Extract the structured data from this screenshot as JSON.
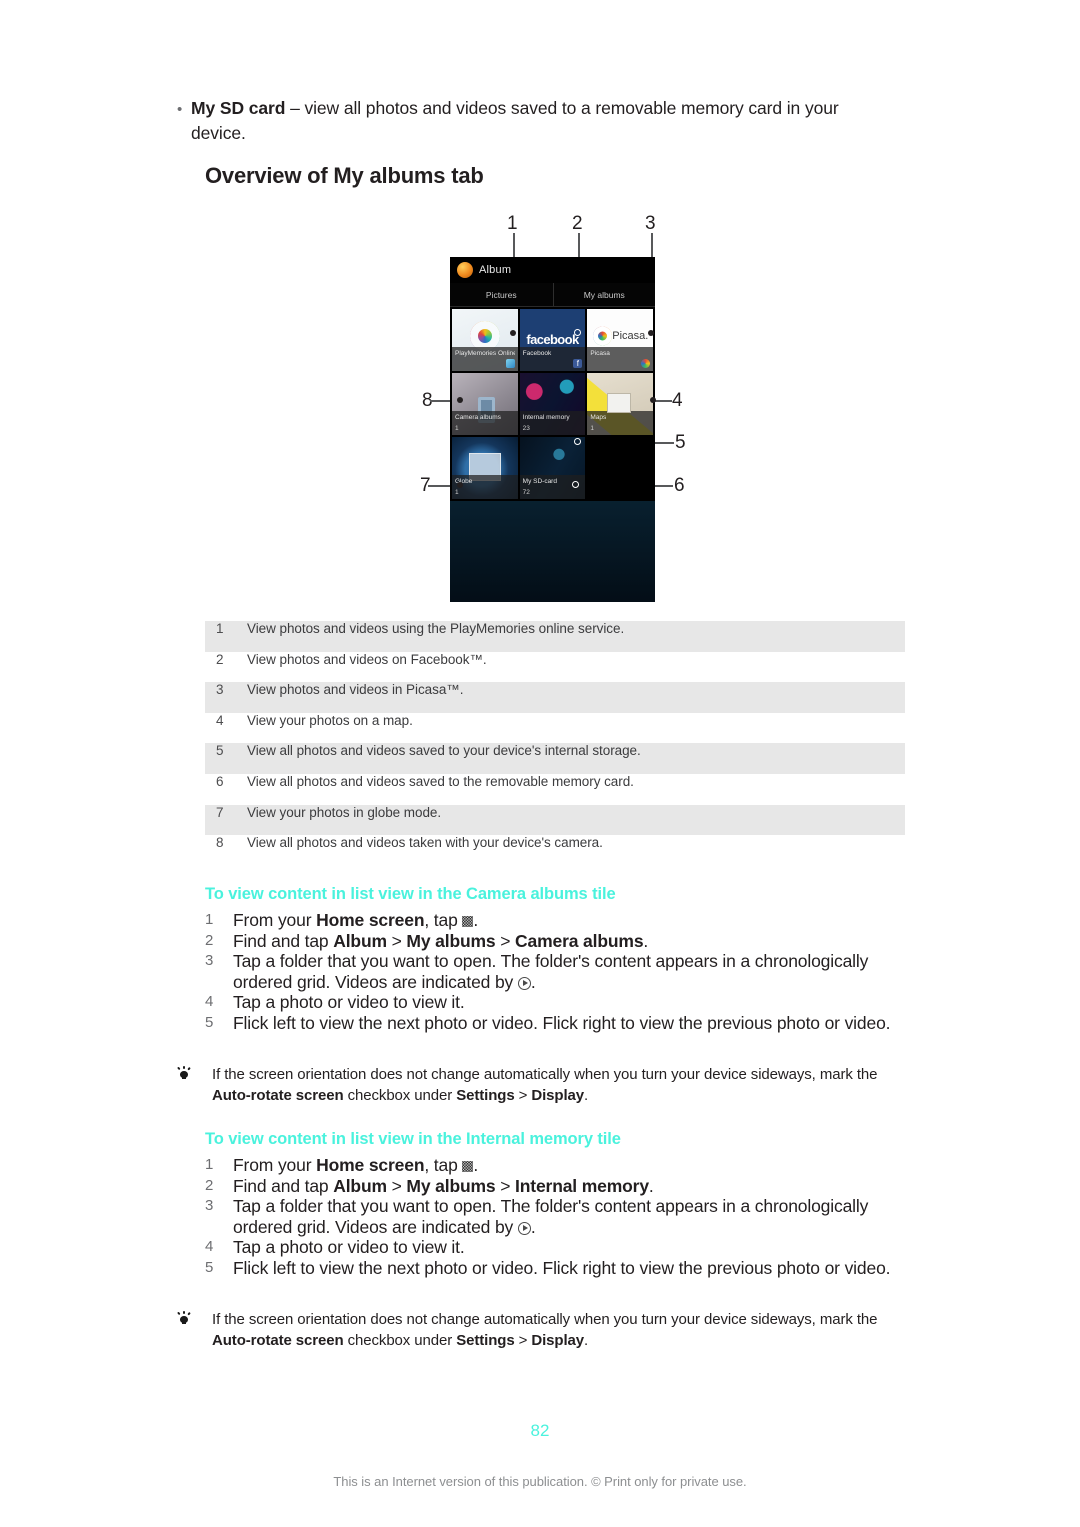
{
  "intro_bullet": {
    "marker": "•",
    "bold_lead": "My SD card",
    "rest": " – view all photos and videos saved to a removable memory card in your device."
  },
  "section_title": "Overview of My albums tab",
  "figure": {
    "callouts": [
      "1",
      "2",
      "3",
      "4",
      "5",
      "6",
      "7",
      "8"
    ],
    "phone": {
      "app_title": "Album",
      "tabs": [
        "Pictures",
        "My albums"
      ],
      "tiles": [
        {
          "name": "PlayMemories Online",
          "count": "",
          "art": "art-playmem",
          "badge": "badge-playmem",
          "badge_text": ""
        },
        {
          "name": "Facebook",
          "count": "",
          "art": "art-fb",
          "badge": "badge-fb",
          "badge_text": "f"
        },
        {
          "name": "Picasa",
          "count": "",
          "art": "art-picasa",
          "badge": "badge-picasa",
          "badge_text": ""
        },
        {
          "name": "Camera albums",
          "count": "1",
          "art": "art-camera",
          "badge": "",
          "badge_text": ""
        },
        {
          "name": "Internal memory",
          "count": "23",
          "art": "art-internal",
          "badge": "",
          "badge_text": ""
        },
        {
          "name": "Maps",
          "count": "1",
          "art": "art-maps",
          "badge": "",
          "badge_text": ""
        },
        {
          "name": "Globe",
          "count": "1",
          "art": "art-globe",
          "badge": "",
          "badge_text": ""
        },
        {
          "name": "My SD-card",
          "count": "72",
          "art": "art-sdcard",
          "badge": "",
          "badge_text": ""
        }
      ]
    }
  },
  "legend_rows": [
    {
      "num": "1",
      "text": "View photos and videos using the PlayMemories online service."
    },
    {
      "num": "2",
      "text": "View photos and videos on Facebook™."
    },
    {
      "num": "3",
      "text": "View photos and videos in Picasa™."
    },
    {
      "num": "4",
      "text": "View your photos on a map."
    },
    {
      "num": "5",
      "text": "View all photos and videos saved to your device's internal storage."
    },
    {
      "num": "6",
      "text": "View all photos and videos saved to the removable memory card."
    },
    {
      "num": "7",
      "text": "View your photos in globe mode."
    },
    {
      "num": "8",
      "text": "View all photos and videos taken with your device's camera."
    }
  ],
  "procedure_camera": {
    "heading": "To view content in list view in the Camera albums tile",
    "steps": {
      "s1_num": "1",
      "s1_a": "From your ",
      "s1_b": "Home screen",
      "s1_c": ", tap ",
      "s1_d": ".",
      "s2_num": "2",
      "s2_a": "Find and tap ",
      "s2_b1": "Album",
      "s2_sep1": " > ",
      "s2_b2": "My albums",
      "s2_sep2": " > ",
      "s2_b3": "Camera albums",
      "s2_end": ".",
      "s3_num": "3",
      "s3_a": "Tap a folder that you want to open. The folder's content appears in a chronologically ordered grid. Videos are indicated by ",
      "s3_b": ".",
      "s4_num": "4",
      "s4_a": "Tap a photo or video to view it.",
      "s5_num": "5",
      "s5_a": "Flick left to view the next photo or video. Flick right to view the previous photo or video."
    }
  },
  "tip_one": {
    "a": "If the screen orientation does not change automatically when you turn your device sideways, mark the ",
    "b1": "Auto-rotate screen",
    "c": " checkbox under ",
    "b2": "Settings",
    "sep": " > ",
    "b3": "Display",
    "end": "."
  },
  "procedure_internal": {
    "heading": "To view content in list view in the Internal memory tile",
    "steps": {
      "s1_num": "1",
      "s1_a": "From your ",
      "s1_b": "Home screen",
      "s1_c": ", tap ",
      "s1_d": ".",
      "s2_num": "2",
      "s2_a": "Find and tap ",
      "s2_b1": "Album",
      "s2_sep1": " > ",
      "s2_b2": "My albums",
      "s2_sep2": " > ",
      "s2_b3": "Internal memory",
      "s2_end": ".",
      "s3_num": "3",
      "s3_a": "Tap a folder that you want to open. The folder's content appears in a chronologically ordered grid. Videos are indicated by ",
      "s3_b": ".",
      "s4_num": "4",
      "s4_a": "Tap a photo or video to view it.",
      "s5_num": "5",
      "s5_a": "Flick left to view the next photo or video. Flick right to view the previous photo or video."
    }
  },
  "tip_two": {
    "a": "If the screen orientation does not change automatically when you turn your device sideways, mark the ",
    "b1": "Auto-rotate screen",
    "c": " checkbox under ",
    "b2": "Settings",
    "sep": " > ",
    "b3": "Display",
    "end": "."
  },
  "page_number": "82",
  "footer_note": "This is an Internet version of this publication. © Print only for private use.",
  "colors": {
    "heading_cyan": "#4af2dd",
    "body_text": "#231f20",
    "table_alt_row": "#e7e7e7",
    "footer_gray": "#8d8f91"
  }
}
